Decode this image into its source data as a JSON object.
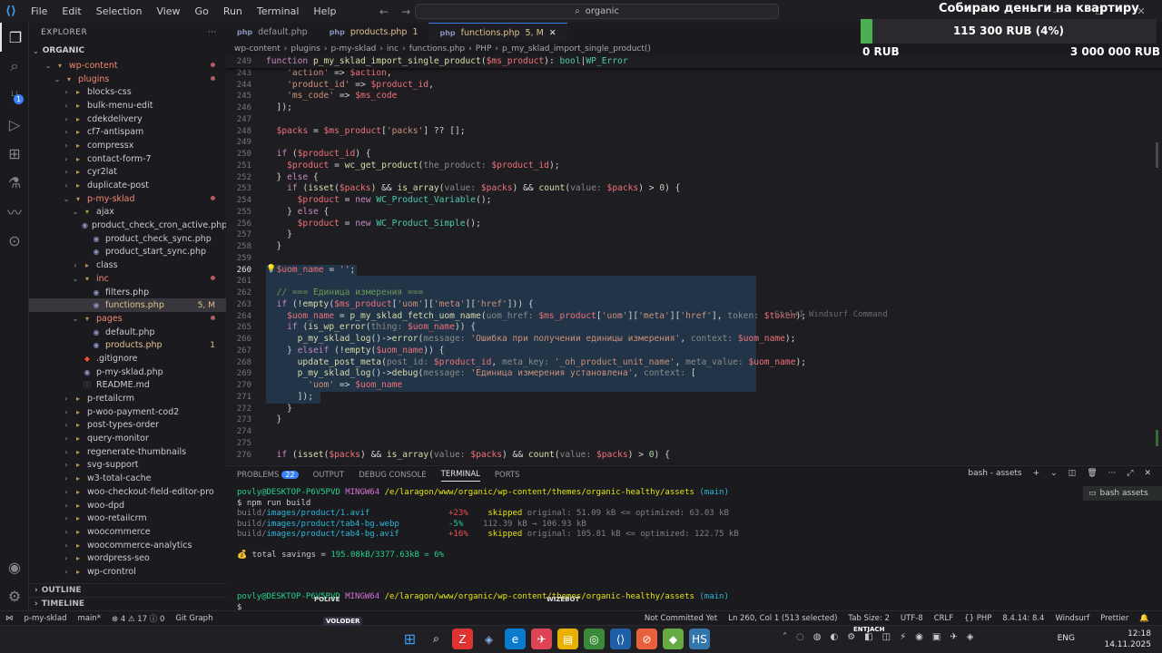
{
  "titlebar": {
    "menu": [
      "File",
      "Edit",
      "Selection",
      "View",
      "Go",
      "Run",
      "Terminal",
      "Help"
    ],
    "search": "organic"
  },
  "donation": {
    "title": "Собираю деньги на квартиру",
    "amount": "115 300 RUB (4%)",
    "progress_percent": 4,
    "min": "0 RUB",
    "max": "3 000 000 RUB"
  },
  "sidebar": {
    "header": "EXPLORER",
    "root": "ORGANIC",
    "items": [
      {
        "label": "wp-content",
        "kind": "folder-open",
        "indent": 1,
        "mod": true
      },
      {
        "label": "plugins",
        "kind": "folder-open",
        "indent": 2,
        "mod": true
      },
      {
        "label": "blocks-css",
        "kind": "folder",
        "indent": 3
      },
      {
        "label": "bulk-menu-edit",
        "kind": "folder",
        "indent": 3
      },
      {
        "label": "cdekdelivery",
        "kind": "folder",
        "indent": 3
      },
      {
        "label": "cf7-antispam",
        "kind": "folder",
        "indent": 3
      },
      {
        "label": "compressx",
        "kind": "folder",
        "indent": 3
      },
      {
        "label": "contact-form-7",
        "kind": "folder",
        "indent": 3
      },
      {
        "label": "cyr2lat",
        "kind": "folder",
        "indent": 3
      },
      {
        "label": "duplicate-post",
        "kind": "folder",
        "indent": 3
      },
      {
        "label": "p-my-sklad",
        "kind": "folder-open",
        "indent": 3,
        "mod": true
      },
      {
        "label": "ajax",
        "kind": "folder-open",
        "indent": 4
      },
      {
        "label": "product_check_cron_active.php",
        "kind": "php",
        "indent": 5
      },
      {
        "label": "product_check_sync.php",
        "kind": "php",
        "indent": 5
      },
      {
        "label": "product_start_sync.php",
        "kind": "php",
        "indent": 5
      },
      {
        "label": "class",
        "kind": "folder",
        "indent": 4
      },
      {
        "label": "inc",
        "kind": "folder-open",
        "indent": 4,
        "mod": true
      },
      {
        "label": "filters.php",
        "kind": "php",
        "indent": 5
      },
      {
        "label": "functions.php",
        "kind": "php",
        "indent": 5,
        "status": "5, M",
        "selected": true
      },
      {
        "label": "pages",
        "kind": "folder-open",
        "indent": 4,
        "mod": true
      },
      {
        "label": "default.php",
        "kind": "php",
        "indent": 5
      },
      {
        "label": "products.php",
        "kind": "php",
        "indent": 5,
        "status": "1"
      },
      {
        "label": ".gitignore",
        "kind": "git",
        "indent": 4
      },
      {
        "label": "p-my-sklad.php",
        "kind": "php",
        "indent": 4
      },
      {
        "label": "README.md",
        "kind": "md",
        "indent": 4
      },
      {
        "label": "p-retailcrm",
        "kind": "folder",
        "indent": 3
      },
      {
        "label": "p-woo-payment-cod2",
        "kind": "folder",
        "indent": 3
      },
      {
        "label": "post-types-order",
        "kind": "folder",
        "indent": 3
      },
      {
        "label": "query-monitor",
        "kind": "folder",
        "indent": 3
      },
      {
        "label": "regenerate-thumbnails",
        "kind": "folder",
        "indent": 3
      },
      {
        "label": "svg-support",
        "kind": "folder",
        "indent": 3
      },
      {
        "label": "w3-total-cache",
        "kind": "folder",
        "indent": 3
      },
      {
        "label": "woo-checkout-field-editor-pro",
        "kind": "folder",
        "indent": 3
      },
      {
        "label": "woo-dpd",
        "kind": "folder",
        "indent": 3
      },
      {
        "label": "woo-retailcrm",
        "kind": "folder",
        "indent": 3
      },
      {
        "label": "woocommerce",
        "kind": "folder",
        "indent": 3
      },
      {
        "label": "woocommerce-analytics",
        "kind": "folder",
        "indent": 3
      },
      {
        "label": "wordpress-seo",
        "kind": "folder",
        "indent": 3
      },
      {
        "label": "wp-crontrol",
        "kind": "folder",
        "indent": 3
      }
    ],
    "outline": "OUTLINE",
    "timeline": "TIMELINE"
  },
  "tabs": [
    {
      "label": "default.php",
      "status": "",
      "active": false
    },
    {
      "label": "products.php",
      "status": "1",
      "active": false
    },
    {
      "label": "functions.php",
      "status": "5, M",
      "active": true
    }
  ],
  "breadcrumbs": [
    "wp-content",
    "plugins",
    "p-my-sklad",
    "inc",
    "functions.php",
    "PHP",
    "p_my_sklad_import_single_product()"
  ],
  "editor": {
    "current_line": "260",
    "hint": "Ctrl+I Windsurf Command",
    "lines": [
      {
        "n": "249",
        "html": "<span class='k'>function</span> <span class='f'>p_my_sklad_import_single_product</span>(<span class='v'>$ms_product</span>): <span class='t'>bool</span>|<span class='t'>WP_Error</span>"
      },
      {
        "n": "243",
        "html": "    <span class='s'>'action'</span> => <span class='v'>$action</span>,"
      },
      {
        "n": "244",
        "html": "    <span class='s'>'product_id'</span> => <span class='v'>$product_id</span>,"
      },
      {
        "n": "245",
        "html": "    <span class='s'>'ms_code'</span> => <span class='v'>$ms_code</span>"
      },
      {
        "n": "246",
        "html": "  ]);"
      },
      {
        "n": "247",
        "html": ""
      },
      {
        "n": "248",
        "html": "  <span class='v'>$packs</span> = <span class='v'>$ms_product</span>[<span class='s'>'packs'</span>] ?? [];"
      },
      {
        "n": "249",
        "html": ""
      },
      {
        "n": "250",
        "html": "  <span class='k'>if</span> (<span class='v'>$product_id</span>) {"
      },
      {
        "n": "251",
        "html": "    <span class='v'>$product</span> = <span class='f'>wc_get_product</span>(<span class='h'>the_product:</span> <span class='v'>$product_id</span>);"
      },
      {
        "n": "252",
        "html": "  } <span class='k'>else</span> {"
      },
      {
        "n": "253",
        "html": "    <span class='k'>if</span> (<span class='f'>isset</span>(<span class='v'>$packs</span>) && <span class='f'>is_array</span>(<span class='h'>value:</span> <span class='v'>$packs</span>) && <span class='f'>count</span>(<span class='h'>value:</span> <span class='v'>$packs</span>) > <span class='n'>0</span>) {"
      },
      {
        "n": "254",
        "html": "      <span class='v'>$product</span> = <span class='k'>new</span> <span class='t'>WC_Product_Variable</span>();"
      },
      {
        "n": "255",
        "html": "    } <span class='k'>else</span> {"
      },
      {
        "n": "256",
        "html": "      <span class='v'>$product</span> = <span class='k'>new</span> <span class='t'>WC_Product_Simple</span>();"
      },
      {
        "n": "257",
        "html": "    }"
      },
      {
        "n": "258",
        "html": "  }"
      },
      {
        "n": "259",
        "html": ""
      },
      {
        "n": "260",
        "html": "  <span class='v'>$uom_name</span> = <span class='s'>''</span>;"
      },
      {
        "n": "261",
        "html": ""
      },
      {
        "n": "262",
        "html": "  <span class='c'>// === Единица измерения ===</span>"
      },
      {
        "n": "263",
        "html": "  <span class='k'>if</span> (!<span class='f'>empty</span>(<span class='v'>$ms_product</span>[<span class='s'>'uom'</span>][<span class='s'>'meta'</span>][<span class='s'>'href'</span>])) {"
      },
      {
        "n": "264",
        "html": "    <span class='v'>$uom_name</span> = <span class='f'>p_my_sklad_fetch_uom_name</span>(<span class='h'>uom_href:</span> <span class='v'>$ms_product</span>[<span class='s'>'uom'</span>][<span class='s'>'meta'</span>][<span class='s'>'href'</span>], <span class='h'>token:</span> <span class='v'>$token</span>);"
      },
      {
        "n": "265",
        "html": "    <span class='k'>if</span> (<span class='f'>is_wp_error</span>(<span class='h'>thing:</span> <span class='v'>$uom_name</span>)) {"
      },
      {
        "n": "266",
        "html": "      <span class='f'>p_my_sklad_log</span>()-><span class='f'>error</span>(<span class='h'>message:</span> <span class='s'>'Ошибка при получении единицы измерения'</span>, <span class='h'>context:</span> <span class='v'>$uom_name</span>);"
      },
      {
        "n": "267",
        "html": "    } <span class='k'>elseif</span> (!<span class='f'>empty</span>(<span class='v'>$uom_name</span>)) {"
      },
      {
        "n": "268",
        "html": "      <span class='f'>update_post_meta</span>(<span class='h'>post_id:</span> <span class='v'>$product_id</span>, <span class='h'>meta_key:</span> <span class='s'>'_oh_product_unit_name'</span>, <span class='h'>meta_value:</span> <span class='v'>$uom_name</span>);"
      },
      {
        "n": "269",
        "html": "      <span class='f'>p_my_sklad_log</span>()-><span class='f'>debug</span>(<span class='h'>message:</span> <span class='s'>'Единица измерения установлена'</span>, <span class='h'>context:</span> ["
      },
      {
        "n": "270",
        "html": "        <span class='s'>'uom'</span> => <span class='v'>$uom_name</span>"
      },
      {
        "n": "271",
        "html": "      ]);"
      },
      {
        "n": "272",
        "html": "    }"
      },
      {
        "n": "273",
        "html": "  }"
      },
      {
        "n": "274",
        "html": ""
      },
      {
        "n": "275",
        "html": ""
      },
      {
        "n": "276",
        "html": "  <span class='k'>if</span> (<span class='f'>isset</span>(<span class='v'>$packs</span>) && <span class='f'>is_array</span>(<span class='h'>value:</span> <span class='v'>$packs</span>) && <span class='f'>count</span>(<span class='h'>value:</span> <span class='v'>$packs</span>) > <span class='n'>0</span>) {"
      }
    ]
  },
  "panel": {
    "tabs": [
      "PROBLEMS",
      "OUTPUT",
      "DEBUG CONSOLE",
      "TERMINAL",
      "PORTS"
    ],
    "problems_count": "22",
    "active_tab": "TERMINAL",
    "terminal_name": "bash - assets",
    "terminal_list_item": "bash  assets",
    "lines": [
      "<span class='g'>povly@DESKTOP-P6V5PVD</span> <span class='m'>MINGW64</span> <span class='y'>/e/laragon/www/organic/wp-content/themes/organic-healthy/assets</span> <span class='cy'>(main)</span>",
      "$ npm run build",
      "<span class='gr'>build/</span><span class='cy'>images/product/1.avif</span>                <span class='r'>+23%</span>    <span class='y'>skipped</span> <span class='gr'>original: 51.09 kB <= optimized: 63.03 kB</span>",
      "<span class='gr'>build/</span><span class='cy'>images/product/tab4-bg.webp</span>          <span class='g'>-5%</span>    <span class='gr'>112.39 kB → 106.93 kB</span>",
      "<span class='gr'>build/</span><span class='cy'>images/product/tab4-bg.avif</span>          <span class='r'>+16%</span>    <span class='y'>skipped</span> <span class='gr'>original: 105.81 kB <= optimized: 122.75 kB</span>",
      "",
      "<span class='o'>💰</span> total savings = <span class='g'>195.08kB/3377.63kB = 6%</span>",
      "",
      "",
      "",
      "<span class='g'>povly@DESKTOP-P6V5PVD</span> <span class='m'>MINGW64</span> <span class='y'>/e/laragon/www/organic/wp-content/themes/organic-healthy/assets</span> <span class='cy'>(main)</span>",
      "$ "
    ]
  },
  "statusbar": {
    "left": [
      "p-my-sklad",
      "main*",
      "⊗ 4  ⚠ 17  ⓘ 0",
      "Git Graph"
    ],
    "right": [
      "Not Committed Yet",
      "Ln 260, Col 1 (513 selected)",
      "Tab Size: 2",
      "UTF-8",
      "CRLF",
      "{} PHP",
      "8.4.14: 8.4",
      "Windsurf",
      "Prettier"
    ]
  },
  "taskbar": {
    "lang": "ENG",
    "time": "12:18",
    "date": "14.11.2025",
    "sticker_left": "VOLODER",
    "sticker_right": "ENTJACH",
    "sticker_mid_left": "POLIVE",
    "sticker_mid_right": "WIZEBOT"
  }
}
